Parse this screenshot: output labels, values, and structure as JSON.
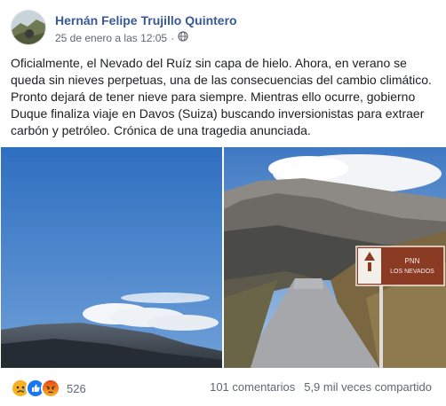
{
  "post": {
    "author": "Hernán Felipe Trujillo Quintero",
    "date": "25 de enero a las 12:05",
    "separator": "·",
    "privacy_icon": "globe-icon",
    "text": "Oficialmente, el Nevado del Ruíz sin capa de hielo. Ahora, en verano se queda sin nieves perpetuas, una de las consecuencias del cambio climático. Pronto dejará de tener nieve para siempre. Mientras ello ocurre, gobierno Duque finaliza viaje en Davos (Suiza) buscando inversionistas para extraer carbón y petróleo. Crónica de una tragedia anunciada."
  },
  "photos": {
    "right": {
      "sign_line1": "PNN",
      "sign_line2": "LOS NEVADOS"
    }
  },
  "footer": {
    "reaction_icons": [
      "sad-reaction-icon",
      "like-reaction-icon",
      "angry-reaction-icon"
    ],
    "reaction_count": "526",
    "comments": "101 comentarios",
    "shares": "5,9 mil veces compartido"
  },
  "colors": {
    "author_link": "#385898",
    "meta_text": "#606770",
    "sign_brown": "#8b3a23"
  }
}
